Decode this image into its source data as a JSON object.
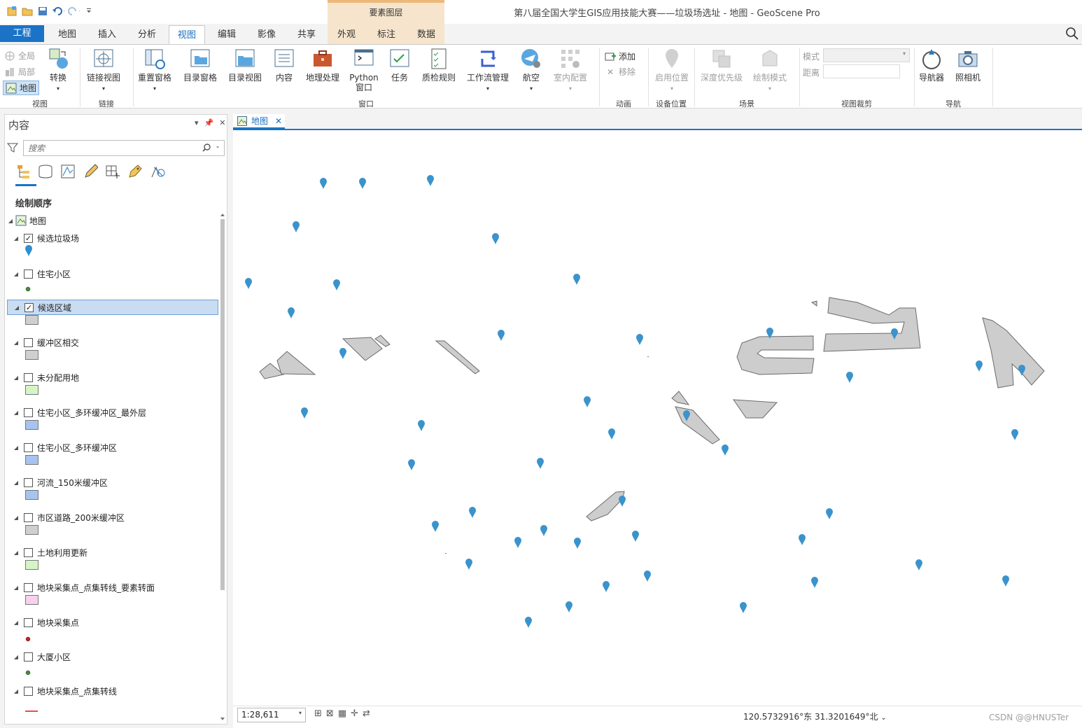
{
  "window": {
    "title": "第八届全国大学生GIS应用技能大赛——垃圾场选址 - 地图 - GeoScene Pro",
    "context_tab_group": "要素图层",
    "watermark": "CSDN @@HNUSTer"
  },
  "tabs": [
    "工程",
    "地图",
    "插入",
    "分析",
    "视图",
    "编辑",
    "影像",
    "共享",
    "外观",
    "标注",
    "数据"
  ],
  "active_tab": "视图",
  "ribbon": {
    "view_group": {
      "label": "视图",
      "full": "全局",
      "local": "局部",
      "map": "地图",
      "convert": "转换"
    },
    "link_group": {
      "label": "链接",
      "link_views": "链接视图"
    },
    "window_group": {
      "label": "窗口",
      "reset_panes": "重置窗格",
      "catalog_pane": "目录窗格",
      "catalog_view": "目录视图",
      "contents": "内容",
      "geoprocessing": "地理处理",
      "python_line1": "Python",
      "python_line2": "窗口",
      "tasks": "任务",
      "quality": "质检规则",
      "workflow": "工作流管理",
      "aviation": "航空",
      "indoor": "室内配置"
    },
    "animation_group": {
      "label": "动画",
      "add": "添加",
      "remove": "移除"
    },
    "device_group": {
      "label": "设备位置",
      "enable": "启用位置"
    },
    "scene_group": {
      "label": "场景",
      "depth": "深度优先级",
      "draw_mode": "绘制模式"
    },
    "clip_group": {
      "label": "视图裁剪",
      "mode": "模式",
      "distance": "距离"
    },
    "nav_group": {
      "label": "导航",
      "navigator": "导航器",
      "camera": "照相机"
    }
  },
  "contents_pane": {
    "title": "内容",
    "search_placeholder": "搜索",
    "draw_order": "绘制顺序",
    "map_name": "地图",
    "layers": [
      {
        "name": "候选垃圾场",
        "checked": true,
        "symbol": "pin",
        "color": "#2f8fd0"
      },
      {
        "name": "住宅小区",
        "checked": false,
        "symbol": "dot",
        "color": "#3f8f2f"
      },
      {
        "name": "候选区域",
        "checked": true,
        "symbol": "rect",
        "color": "#cfcfcf",
        "selected": true
      },
      {
        "name": "缓冲区相交",
        "checked": false,
        "symbol": "rect",
        "color": "#cfcfcf"
      },
      {
        "name": "未分配用地",
        "checked": false,
        "symbol": "rect",
        "color": "#d6f5c6"
      },
      {
        "name": "住宅小区_多环缓冲区_最外层",
        "checked": false,
        "symbol": "rect",
        "color": "#a7c4ef"
      },
      {
        "name": "住宅小区_多环缓冲区",
        "checked": false,
        "symbol": "rect",
        "color": "#a7c4ef"
      },
      {
        "name": "河流_150米缓冲区",
        "checked": false,
        "symbol": "rect",
        "color": "#a7c4ef"
      },
      {
        "name": "市区道路_200米缓冲区",
        "checked": false,
        "symbol": "rect",
        "color": "#cfcfcf"
      },
      {
        "name": "土地利用更新",
        "checked": false,
        "symbol": "rect",
        "color": "#d6f5c6"
      },
      {
        "name": "地块采集点_点集转线_要素转面",
        "checked": false,
        "symbol": "rect",
        "color": "#f8d2ec"
      },
      {
        "name": "地块采集点",
        "checked": false,
        "symbol": "dot",
        "color": "#cc1f1f"
      },
      {
        "name": "大厦小区",
        "checked": false,
        "symbol": "dot",
        "color": "#3f8f2f"
      },
      {
        "name": "地块采集点_点集转线",
        "checked": false,
        "symbol": "line",
        "color": "#e05050"
      }
    ]
  },
  "map_view": {
    "tab_label": "地图",
    "scale": "1:28,611",
    "coordinates": "120.5732916°东 31.3201649°北",
    "pin_color": "#3a93cc",
    "polygon_fill": "#cdcdcd",
    "polygon_stroke": "#6a6a6a"
  }
}
